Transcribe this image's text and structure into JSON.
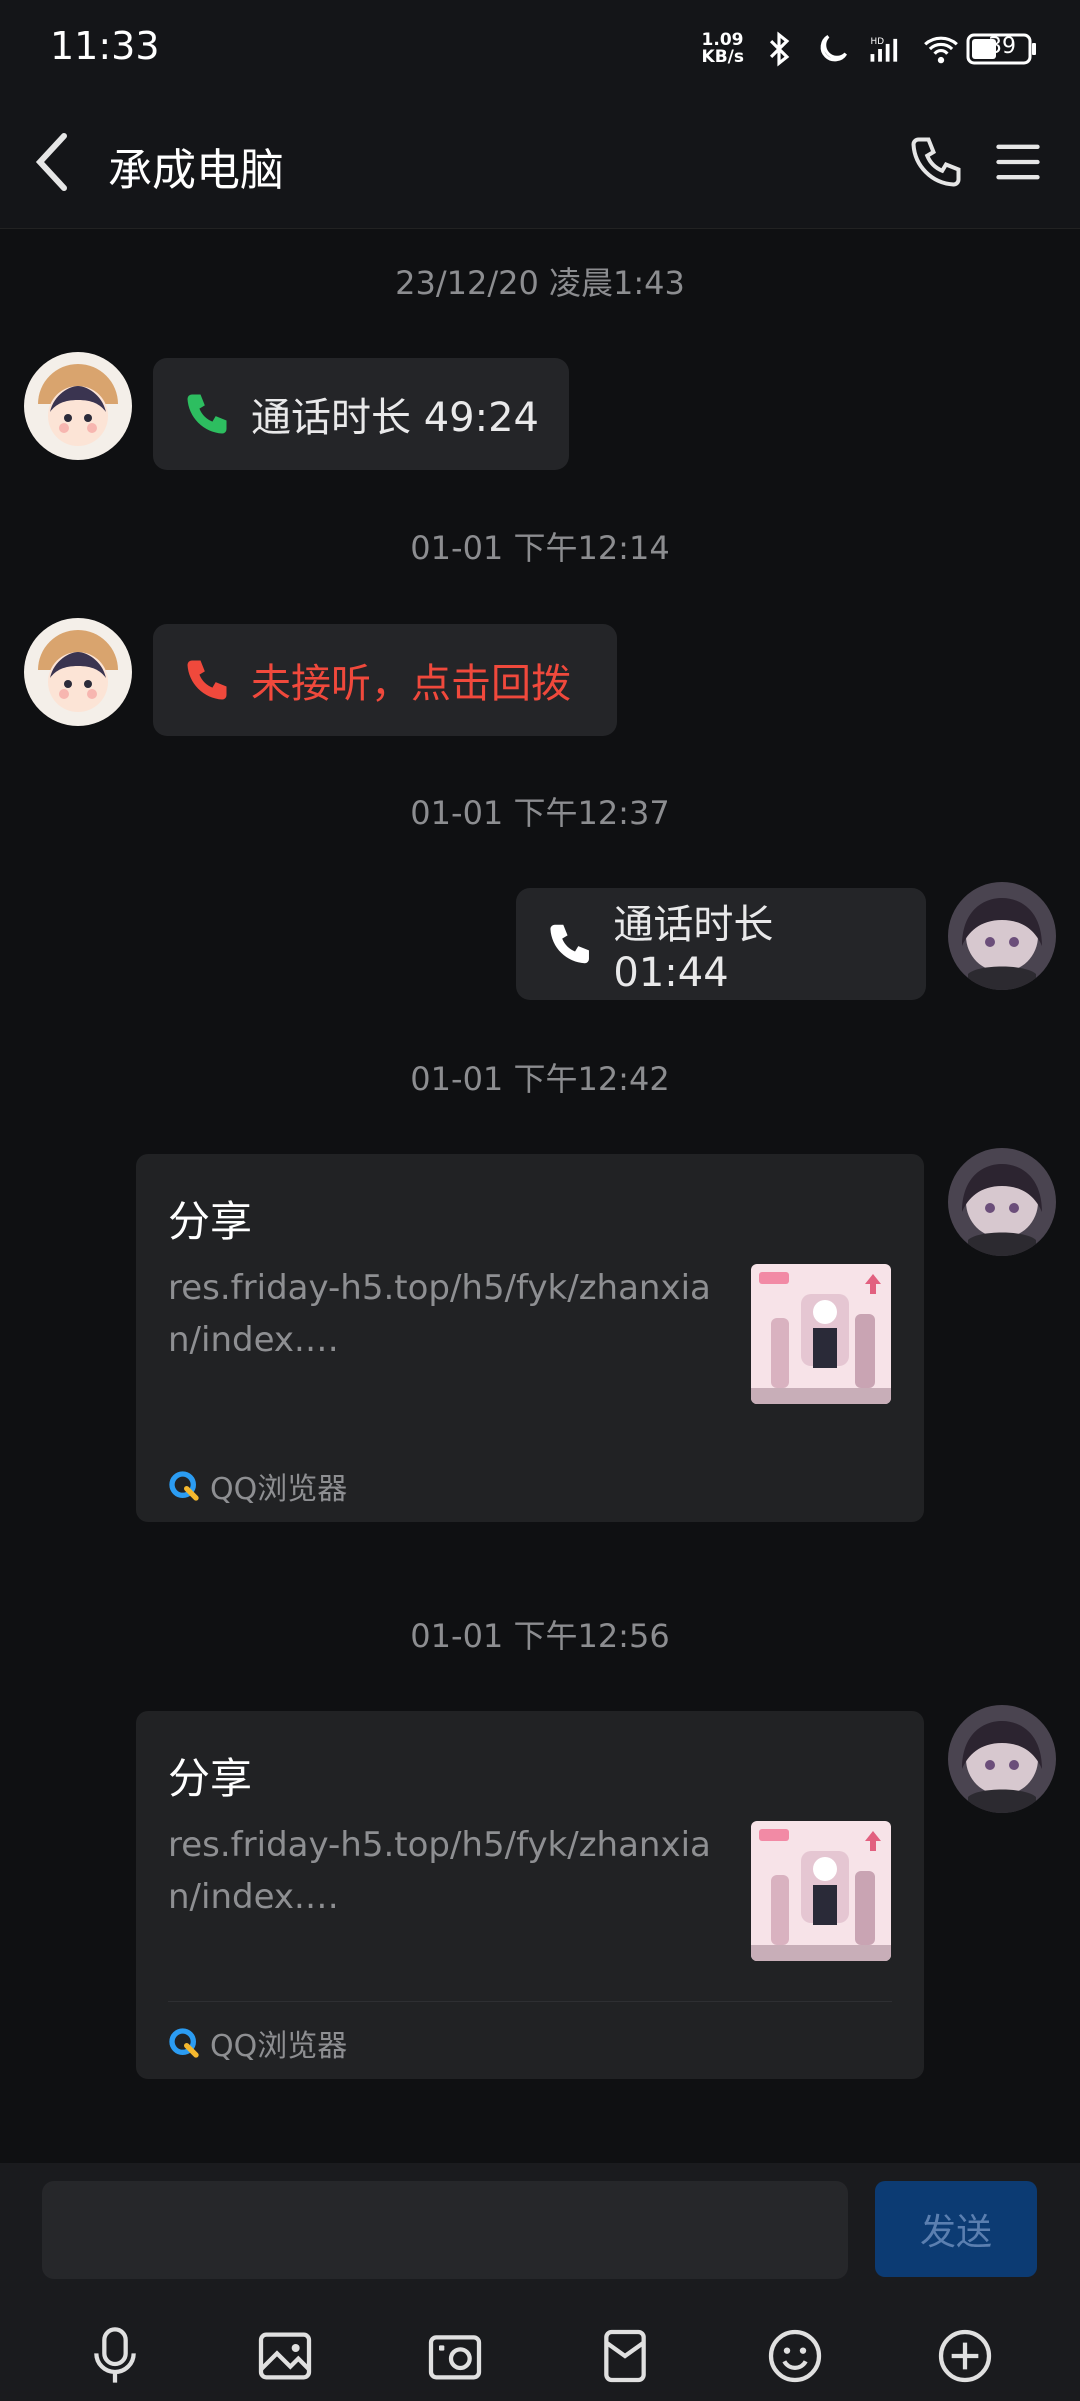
{
  "status": {
    "time": "11:33",
    "net_speed_top": "1.09",
    "net_speed_bottom": "KB/s",
    "battery": "39"
  },
  "header": {
    "title": "承成电脑"
  },
  "messages": {
    "ts1": "23/12/20 凌晨1:43",
    "call1": "通话时长 49:24",
    "ts2": "01-01 下午12:14",
    "missed": "未接听，点击回拨",
    "ts3": "01-01 下午12:37",
    "call2": "通话时长 01:44",
    "ts4": "01-01 下午12:42",
    "ts5": "01-01 下午12:56"
  },
  "cards": [
    {
      "title": "分享",
      "url": "res.friday-h5.top/h5/fyk/zhanxian/index.…",
      "source": "QQ浏览器"
    },
    {
      "title": "分享",
      "url": "res.friday-h5.top/h5/fyk/zhanxian/index.…",
      "source": "QQ浏览器"
    }
  ],
  "input": {
    "placeholder": "",
    "send_label": "发送"
  },
  "toolbar": [
    "mic-icon",
    "image-icon",
    "camera-icon",
    "redpacket-icon",
    "emoji-icon",
    "plus-icon"
  ],
  "colors": {
    "missed": "#f0493c",
    "call_green": "#2dbe60",
    "send_bg": "#0c3b73"
  }
}
